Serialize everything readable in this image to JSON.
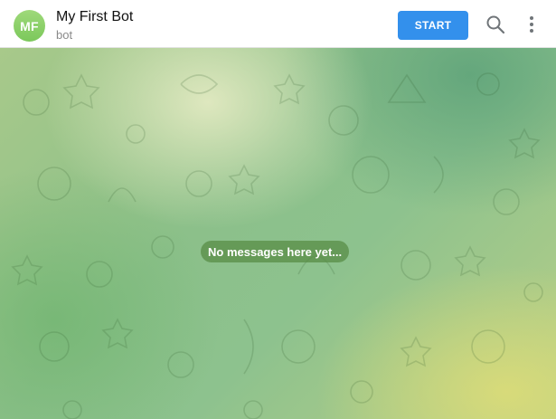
{
  "header": {
    "avatar_initials": "MF",
    "title": "My First Bot",
    "subtitle": "bot",
    "start_label": "START",
    "search_icon": "search-icon",
    "more_icon": "more-vertical-icon"
  },
  "chat": {
    "empty_message": "No messages here yet..."
  },
  "colors": {
    "accent": "#3390ec",
    "avatar": "#8ccf6a",
    "pill_bg": "#5e8c46"
  }
}
